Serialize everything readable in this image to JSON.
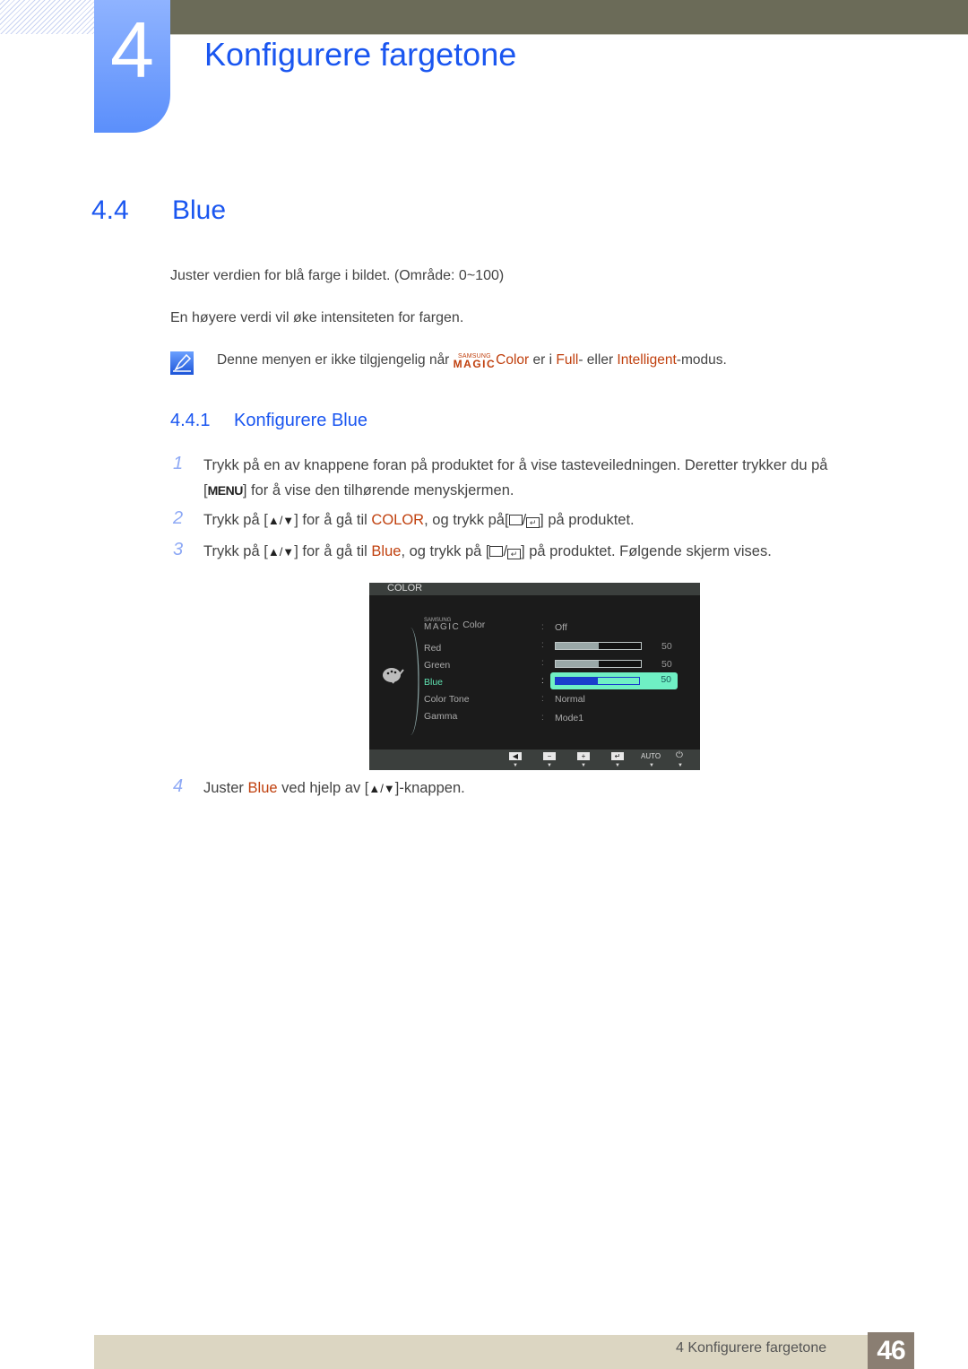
{
  "header": {
    "chapter_number": "4",
    "chapter_title": "Konfigurere fargetone"
  },
  "section": {
    "number": "4.4",
    "title": "Blue",
    "paragraphs": [
      "Juster verdien for blå farge i bildet. (Område: 0~100)",
      "En høyere verdi vil øke intensiteten for fargen."
    ],
    "note": {
      "icon": "note-pen-icon",
      "prefix": "Denne menyen er ikke tilgjengelig når ",
      "magic_top": "SAMSUNG",
      "magic_bottom": "MAGIC",
      "color_word": "Color",
      "mid": " er i ",
      "full": "Full",
      "mid2": "- eller ",
      "intelligent": "Intelligent",
      "suffix": "-modus."
    }
  },
  "subsection": {
    "number": "4.4.1",
    "title": "Konfigurere Blue"
  },
  "steps": [
    {
      "num": "1",
      "line1": "Trykk på en av knappene foran på produktet for å vise tasteveiledningen. Deretter trykker du på",
      "key": "MENU",
      "line2": " for å vise den tilhørende menyskjermen."
    },
    {
      "num": "2",
      "pre": "Trykk på [",
      "arrows": "▲/▼",
      "mid": "] for å gå til ",
      "target": "COLOR",
      "mid2": ", og trykk på[",
      "post": "] på produktet."
    },
    {
      "num": "3",
      "pre": "Trykk på [",
      "arrows": "▲/▼",
      "mid": "] for å gå til ",
      "target": "Blue",
      "mid2": ", og trykk på [",
      "post": "] på produktet. Følgende skjerm vises."
    },
    {
      "num": "4",
      "pre": "Juster ",
      "target": "Blue",
      "mid": " ved hjelp av [",
      "arrows": "▲/▼",
      "post": "]-knappen."
    }
  ],
  "osd": {
    "title": "COLOR",
    "menu_icon": "palette-icon",
    "items": [
      {
        "label_top": "SAMSUNG",
        "label_magic": "MAGIC",
        "label": "Color",
        "value": "Off"
      },
      {
        "label": "Red",
        "bar_percent": 50,
        "value": "50"
      },
      {
        "label": "Green",
        "bar_percent": 50,
        "value": "50"
      },
      {
        "label": "Blue",
        "bar_percent": 50,
        "value": "50",
        "selected": true
      },
      {
        "label": "Color Tone",
        "value": "Normal"
      },
      {
        "label": "Gamma",
        "value": "Mode1"
      }
    ],
    "buttons": [
      {
        "icon": "left-arrow-icon",
        "glyph": "◀"
      },
      {
        "icon": "minus-icon",
        "glyph": "−"
      },
      {
        "icon": "plus-icon",
        "glyph": "+"
      },
      {
        "icon": "enter-icon",
        "glyph": "↵"
      },
      {
        "label": "AUTO"
      },
      {
        "icon": "power-icon",
        "glyph": "⏻"
      }
    ],
    "colon": ":",
    "arrow_glyph": "▼"
  },
  "footer": {
    "text": "4 Konfigurere fargetone",
    "page": "46"
  }
}
